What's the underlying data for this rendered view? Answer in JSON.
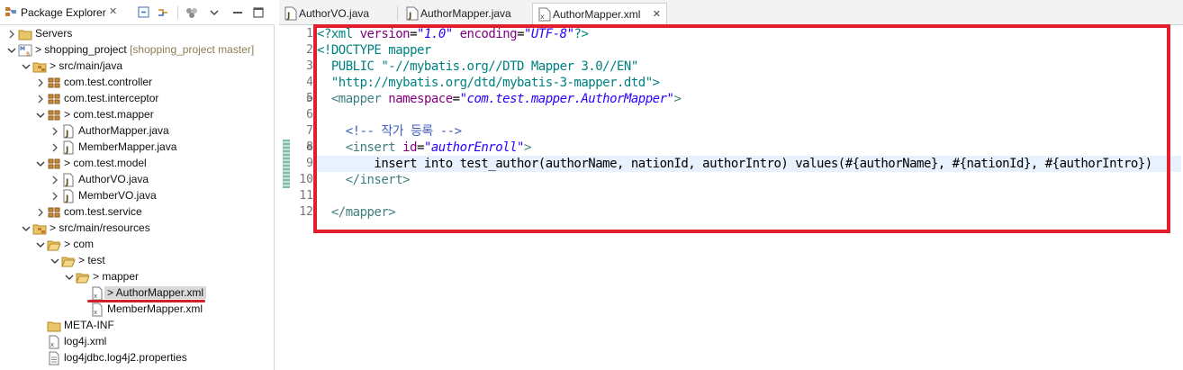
{
  "explorer": {
    "title": "Package Explorer",
    "close": "✕",
    "tree": [
      {
        "id": "servers",
        "label": "Servers",
        "extra": "",
        "depth": 0,
        "arrow": "collapsed",
        "icon": "folder-icon"
      },
      {
        "id": "project",
        "label": "> shopping_project",
        "extra": " [shopping_project master]",
        "depth": 0,
        "arrow": "expanded",
        "icon": "project-icon"
      },
      {
        "id": "src-main-java",
        "label": "> src/main/java",
        "extra": "",
        "depth": 1,
        "arrow": "expanded",
        "icon": "source-folder-icon"
      },
      {
        "id": "pkg-controller",
        "label": "com.test.controller",
        "extra": "",
        "depth": 2,
        "arrow": "collapsed",
        "icon": "package-icon"
      },
      {
        "id": "pkg-interceptor",
        "label": "com.test.interceptor",
        "extra": "",
        "depth": 2,
        "arrow": "collapsed",
        "icon": "package-icon"
      },
      {
        "id": "pkg-mapper",
        "label": "> com.test.mapper",
        "extra": "",
        "depth": 2,
        "arrow": "expanded",
        "icon": "package-icon"
      },
      {
        "id": "author-mapper-java",
        "label": "AuthorMapper.java",
        "extra": "",
        "depth": 3,
        "arrow": "collapsed",
        "icon": "java-file-icon"
      },
      {
        "id": "member-mapper-java",
        "label": "MemberMapper.java",
        "extra": "",
        "depth": 3,
        "arrow": "collapsed",
        "icon": "java-file-icon"
      },
      {
        "id": "pkg-model",
        "label": "> com.test.model",
        "extra": "",
        "depth": 2,
        "arrow": "expanded",
        "icon": "package-icon"
      },
      {
        "id": "authorvo-java",
        "label": "AuthorVO.java",
        "extra": "",
        "depth": 3,
        "arrow": "collapsed",
        "icon": "java-file-icon"
      },
      {
        "id": "membervo-java",
        "label": "MemberVO.java",
        "extra": "",
        "depth": 3,
        "arrow": "collapsed",
        "icon": "java-file-icon"
      },
      {
        "id": "pkg-service",
        "label": "com.test.service",
        "extra": "",
        "depth": 2,
        "arrow": "collapsed",
        "icon": "package-icon"
      },
      {
        "id": "src-main-resources",
        "label": "> src/main/resources",
        "extra": "",
        "depth": 1,
        "arrow": "expanded",
        "icon": "source-folder-icon"
      },
      {
        "id": "res-com",
        "label": "> com",
        "extra": "",
        "depth": 2,
        "arrow": "expanded",
        "icon": "folder-open-icon"
      },
      {
        "id": "res-test",
        "label": "> test",
        "extra": "",
        "depth": 3,
        "arrow": "expanded",
        "icon": "folder-open-icon"
      },
      {
        "id": "res-mapper",
        "label": "> mapper",
        "extra": "",
        "depth": 4,
        "arrow": "expanded",
        "icon": "folder-open-icon"
      },
      {
        "id": "author-mapper-xml",
        "label": "> AuthorMapper.xml",
        "extra": "",
        "depth": 5,
        "arrow": "none",
        "icon": "xml-file-icon",
        "selected": true
      },
      {
        "id": "member-mapper-xml",
        "label": "MemberMapper.xml",
        "extra": "",
        "depth": 5,
        "arrow": "none",
        "icon": "xml-file-icon"
      },
      {
        "id": "meta-inf",
        "label": "META-INF",
        "extra": "",
        "depth": 2,
        "arrow": "none",
        "icon": "folder-icon"
      },
      {
        "id": "log4j-xml",
        "label": "log4j.xml",
        "extra": "",
        "depth": 2,
        "arrow": "none",
        "icon": "xml-file-icon"
      },
      {
        "id": "log4jdbc-props",
        "label": "log4jdbc.log4j2.properties",
        "extra": "",
        "depth": 2,
        "arrow": "none",
        "icon": "properties-file-icon"
      }
    ]
  },
  "editor": {
    "tabs": [
      {
        "label": "AuthorVO.java",
        "icon": "java-file-icon",
        "active": false
      },
      {
        "label": "AuthorMapper.java",
        "icon": "java-file-icon",
        "active": false
      },
      {
        "label": "AuthorMapper.xml",
        "icon": "xml-file-icon",
        "active": true,
        "close": "✕"
      }
    ],
    "line_numbers": [
      "1",
      "2",
      "3",
      "4",
      "5",
      "6",
      "7",
      "8",
      "9",
      "10",
      "11",
      "12"
    ],
    "lines": [
      [
        {
          "t": "pi",
          "v": "<?xml "
        },
        {
          "t": "attr",
          "v": "version"
        },
        {
          "t": "text",
          "v": "="
        },
        {
          "t": "str",
          "v": "\"1.0\""
        },
        {
          "t": "text",
          "v": " "
        },
        {
          "t": "attr",
          "v": "encoding"
        },
        {
          "t": "text",
          "v": "="
        },
        {
          "t": "str",
          "v": "\"UTF-8\""
        },
        {
          "t": "pi",
          "v": "?>"
        }
      ],
      [
        {
          "t": "doc",
          "v": "<!DOCTYPE mapper"
        }
      ],
      [
        {
          "t": "doc",
          "v": "  PUBLIC \"-//mybatis.org//DTD Mapper 3.0//EN\""
        }
      ],
      [
        {
          "t": "doc",
          "v": "  \"http://mybatis.org/dtd/mybatis-3-mapper.dtd\">"
        }
      ],
      [
        {
          "t": "text",
          "v": "  "
        },
        {
          "t": "tag",
          "v": "<mapper "
        },
        {
          "t": "attr",
          "v": "namespace"
        },
        {
          "t": "text",
          "v": "="
        },
        {
          "t": "str",
          "v": "\"com.test.mapper.AuthorMapper\""
        },
        {
          "t": "tag",
          "v": ">"
        }
      ],
      [
        {
          "t": "text",
          "v": ""
        }
      ],
      [
        {
          "t": "text",
          "v": "    "
        },
        {
          "t": "comment",
          "v": "<!-- 작가 등록 -->"
        }
      ],
      [
        {
          "t": "text",
          "v": "    "
        },
        {
          "t": "tag",
          "v": "<insert "
        },
        {
          "t": "attr",
          "v": "id"
        },
        {
          "t": "text",
          "v": "="
        },
        {
          "t": "str",
          "v": "\"authorEnroll\""
        },
        {
          "t": "tag",
          "v": ">"
        }
      ],
      [
        {
          "t": "text",
          "v": "        insert into test_author(authorName, nationId, authorIntro) values(#{authorName}, #{nationId}, #{authorIntro})"
        }
      ],
      [
        {
          "t": "text",
          "v": "    "
        },
        {
          "t": "tag",
          "v": "</insert>"
        }
      ],
      [
        {
          "t": "text",
          "v": ""
        }
      ],
      [
        {
          "t": "text",
          "v": "  "
        },
        {
          "t": "tag",
          "v": "</mapper>"
        }
      ]
    ]
  },
  "colors": {
    "annotation_red": "#e0202a",
    "current_line": "#e8f2fe",
    "selected_row": "#d9d9d9"
  }
}
